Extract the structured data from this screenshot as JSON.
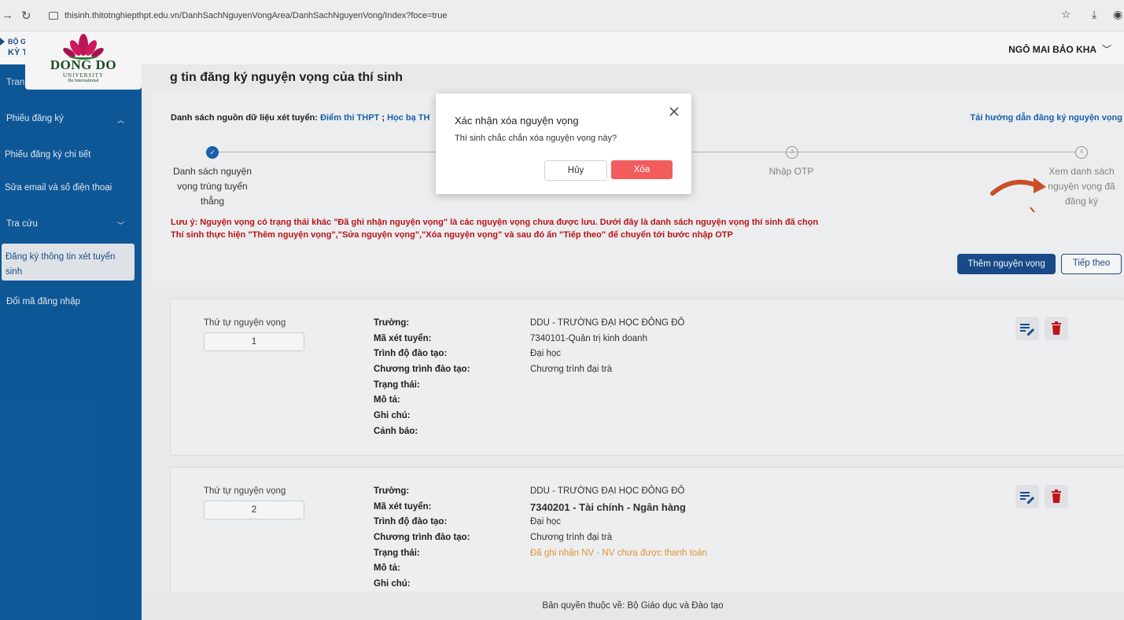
{
  "browser": {
    "url": "thisinh.thitotnghiepthpt.edu.vn/DanhSachNguyenVongArea/DanhSachNguyenVong/Index?foce=true"
  },
  "header": {
    "brand_line1": "BỘ G",
    "brand_line2": "KỲ T",
    "logo_name": "DONG DO",
    "logo_sub": "UNIVERSITY",
    "logo_tag": "Be International",
    "user_name": "NGÔ MAI BẢO KHA"
  },
  "sidebar": {
    "items": [
      {
        "label": "Tran"
      },
      {
        "label": "Phiếu đăng ký"
      },
      {
        "label": "Phiếu đăng ký chi tiết"
      },
      {
        "label": "Sửa email và số điện thoại"
      },
      {
        "label": "Tra cứu"
      },
      {
        "label": "Đăng ký thông tin xét tuyển sinh"
      },
      {
        "label": "Đổi mã đăng nhập"
      }
    ]
  },
  "main": {
    "title": "g tin đăng ký nguyện vọng của thí sinh",
    "source_label": "Danh sách nguồn dữ liệu xét tuyển:",
    "source_link1": "Điểm thi THPT",
    "source_sep": " ; ",
    "source_link2": "Học bạ TH",
    "guide_link": "Tải hướng dẫn đăng ký nguyện vọng",
    "steps": [
      {
        "num": "✓",
        "label": "Danh sách nguyện vọng trúng tuyển thẳng"
      },
      {
        "num": "3",
        "label": "Nhập OTP"
      },
      {
        "num": "4",
        "label": "Xem danh sách nguyện vọng đã đăng ký"
      }
    ],
    "note1": "Lưu ý: Nguyện vọng có trạng thái khác \"Đã ghi nhận nguyện vọng\" là các nguyện vọng chưa được lưu. Dưới đây là danh sách nguyện vọng thí sinh đã chọn",
    "note2": "Thí sinh thực hiện \"Thêm nguyện vọng\",\"Sửa nguyện vọng\",\"Xóa nguyện vọng\" và sau đó ấn \"Tiếp theo\" để chuyển tới bước nhập OTP",
    "add_button": "Thêm nguyện vọng",
    "next_button": "Tiếp theo"
  },
  "field_labels": {
    "order": "Thứ tự nguyện vọng",
    "school": "Trường:",
    "code": "Mã xét tuyển:",
    "level": "Trình độ đào tạo:",
    "program": "Chương trình đào tạo:",
    "status": "Trạng thái:",
    "description": "Mô tả:",
    "note": "Ghi chú:",
    "warning": "Cảnh báo:"
  },
  "wishes": [
    {
      "order": "1",
      "school": "DDU - TRƯỜNG ĐẠI HỌC ĐÔNG ĐÔ",
      "code": "7340101-Quản trị kinh doanh",
      "level": "Đại học",
      "program": "Chương trình đại trà",
      "status": ""
    },
    {
      "order": "2",
      "school": "DDU - TRƯỜNG ĐẠI HỌC ĐÔNG ĐÔ",
      "code": "7340201 - Tài chính - Ngân hàng",
      "level": "Đại học",
      "program": "Chương trình đại trà",
      "status": "Đã ghi nhận NV - NV chưa được thanh toán"
    }
  ],
  "footer": {
    "text": "Bản quyền thuộc về: Bộ Giáo dục và Đào tạo"
  },
  "modal": {
    "title": "Xác nhận xóa nguyện vọng",
    "message": "Thí sinh chắc chắn xóa nguyện vọng này?",
    "cancel_label": "Hủy",
    "confirm_label": "Xóa"
  },
  "colors": {
    "sidebar": "#0f5b9e",
    "primary": "#1a4e8f",
    "danger": "#f25c5c",
    "note": "#c0151b",
    "delete_icon": "#c8141b"
  }
}
